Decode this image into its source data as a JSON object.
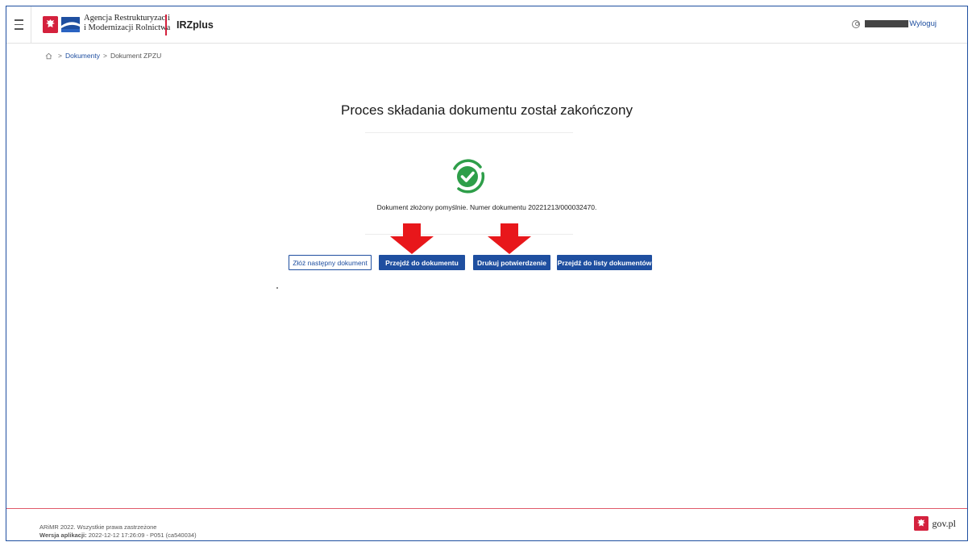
{
  "header": {
    "agency_line1": "Agencja Restrukturyzacji",
    "agency_line2": "i Modernizacji Rolnictwa",
    "app_name": "IRZplus",
    "logout_label": "Wyloguj"
  },
  "breadcrumb": {
    "home_icon": "home-icon",
    "items": [
      "Dokumenty",
      "Dokument ZPZU"
    ]
  },
  "main": {
    "title": "Proces składania dokumentu został zakończony",
    "status_icon": "check-circle-icon",
    "success_message": "Dokument złożony pomyślnie. Numer dokumentu 20221213/000032470."
  },
  "actions": {
    "submit_next": "Złóż następny dokument",
    "go_to_document": "Przejdź do dokumentu",
    "print_confirmation": "Drukuj potwierdzenie",
    "go_to_list": "Przejdź do listy dokumentów"
  },
  "annotations": {
    "arrow_icon": "red-down-arrow-icon",
    "arrow_color": "#e8171b"
  },
  "footer": {
    "copyright": "ARiMR 2022. Wszystkie prawa zastrzeżone",
    "version_label": "Wersja aplikacji:",
    "version_value": "2022-12-12 17:26:09 - P051 (ca540034)",
    "gov_label": "gov.pl"
  },
  "colors": {
    "primary": "#1f4fa0",
    "success": "#2e9e49",
    "brand_red": "#d4213d"
  }
}
